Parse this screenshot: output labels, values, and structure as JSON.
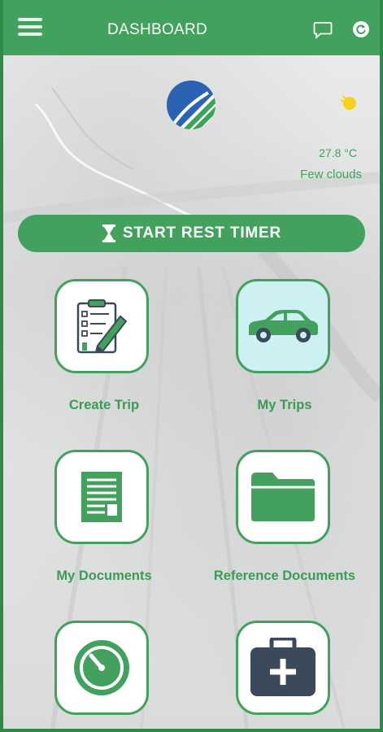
{
  "header": {
    "title": "DASHBOARD",
    "menu_icon": "hamburger-menu-icon",
    "chat_icon": "chat-bubble-icon",
    "refresh_icon": "refresh-icon"
  },
  "weather": {
    "icon": "sun-icon",
    "temperature": "27.8 °C",
    "description": "Few clouds"
  },
  "rest_timer_button": {
    "label": "START REST TIMER",
    "icon": "hourglass-icon"
  },
  "tiles": [
    {
      "label": "Create Trip",
      "icon": "clipboard-pen-icon"
    },
    {
      "label": "My Trips",
      "icon": "car-icon",
      "active": true
    },
    {
      "label": "My Documents",
      "icon": "document-icon"
    },
    {
      "label": "Reference Documents",
      "icon": "folder-icon"
    },
    {
      "label": "",
      "icon": "timer-gauge-icon"
    },
    {
      "label": "",
      "icon": "first-aid-kit-icon"
    }
  ],
  "colors": {
    "primary": "#41a15d",
    "active_tile": "#cdf1f3",
    "logo_blue": "#2b62b3",
    "sun": "#f6d21c",
    "icon_dark": "#3b4a5a"
  }
}
